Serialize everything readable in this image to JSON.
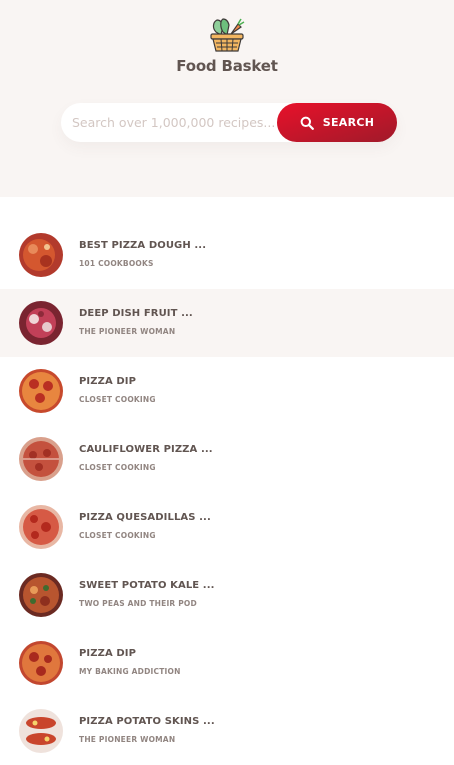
{
  "app": {
    "brand": "Food Basket",
    "logo_icon": "basket-vegetables-icon"
  },
  "search": {
    "placeholder": "Search over 1,000,000 recipes...",
    "value": "",
    "button_label": "SEARCH",
    "button_icon": "search-icon"
  },
  "colors": {
    "accent_start": "#e8112a",
    "accent_end": "#a01a2a",
    "header_bg": "#f9f5f3",
    "text": "#615551",
    "muted": "#918581"
  },
  "results": [
    {
      "title": "BEST PIZZA DOUGH ...",
      "publisher": "101 COOKBOOKS",
      "active": false
    },
    {
      "title": "DEEP DISH FRUIT ...",
      "publisher": "THE PIONEER WOMAN",
      "active": true
    },
    {
      "title": "PIZZA DIP",
      "publisher": "CLOSET COOKING",
      "active": false
    },
    {
      "title": "CAULIFLOWER PIZZA ...",
      "publisher": "CLOSET COOKING",
      "active": false
    },
    {
      "title": "PIZZA QUESADILLAS ...",
      "publisher": "CLOSET COOKING",
      "active": false
    },
    {
      "title": "SWEET POTATO KALE ...",
      "publisher": "TWO PEAS AND THEIR POD",
      "active": false
    },
    {
      "title": "PIZZA DIP",
      "publisher": "MY BAKING ADDICTION",
      "active": false
    },
    {
      "title": "PIZZA POTATO SKINS ...",
      "publisher": "THE PIONEER WOMAN",
      "active": false
    }
  ]
}
